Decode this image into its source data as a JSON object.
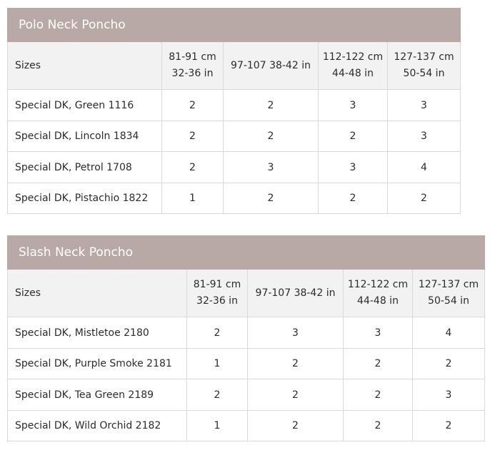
{
  "tables": [
    {
      "title": "Polo Neck Poncho",
      "header_label": "Sizes",
      "sizes": [
        {
          "cm": "81-91 cm",
          "in": "32-36 in"
        },
        {
          "cm": "97-107 38-42 in",
          "in": ""
        },
        {
          "cm": "112-122 cm",
          "in": "44-48 in"
        },
        {
          "cm": "127-137 cm",
          "in": "50-54 in"
        }
      ],
      "rows": [
        {
          "label": "Special DK, Green 1116",
          "values": [
            "2",
            "2",
            "3",
            "3"
          ]
        },
        {
          "label": "Special DK, Lincoln 1834",
          "values": [
            "2",
            "2",
            "2",
            "3"
          ]
        },
        {
          "label": "Special DK, Petrol 1708",
          "values": [
            "2",
            "3",
            "3",
            "4"
          ]
        },
        {
          "label": "Special DK, Pistachio 1822",
          "values": [
            "1",
            "2",
            "2",
            "2"
          ]
        }
      ]
    },
    {
      "title": "Slash Neck Poncho",
      "header_label": "Sizes",
      "sizes": [
        {
          "cm": "81-91 cm",
          "in": "32-36 in"
        },
        {
          "cm": "97-107 38-42 in",
          "in": ""
        },
        {
          "cm": "112-122 cm",
          "in": "44-48 in"
        },
        {
          "cm": "127-137 cm",
          "in": "50-54 in"
        }
      ],
      "rows": [
        {
          "label": "Special DK, Mistletoe 2180",
          "values": [
            "2",
            "3",
            "3",
            "4"
          ]
        },
        {
          "label": "Special DK, Purple Smoke 2181",
          "values": [
            "1",
            "2",
            "2",
            "2"
          ]
        },
        {
          "label": "Special DK, Tea Green 2189",
          "values": [
            "2",
            "2",
            "2",
            "3"
          ]
        },
        {
          "label": "Special DK, Wild Orchid 2182",
          "values": [
            "1",
            "2",
            "2",
            "2"
          ]
        }
      ]
    }
  ],
  "colors": {
    "title_bg": "#b8a9a7",
    "header_bg": "#f2f2f2",
    "border": "#d9d9d9"
  }
}
